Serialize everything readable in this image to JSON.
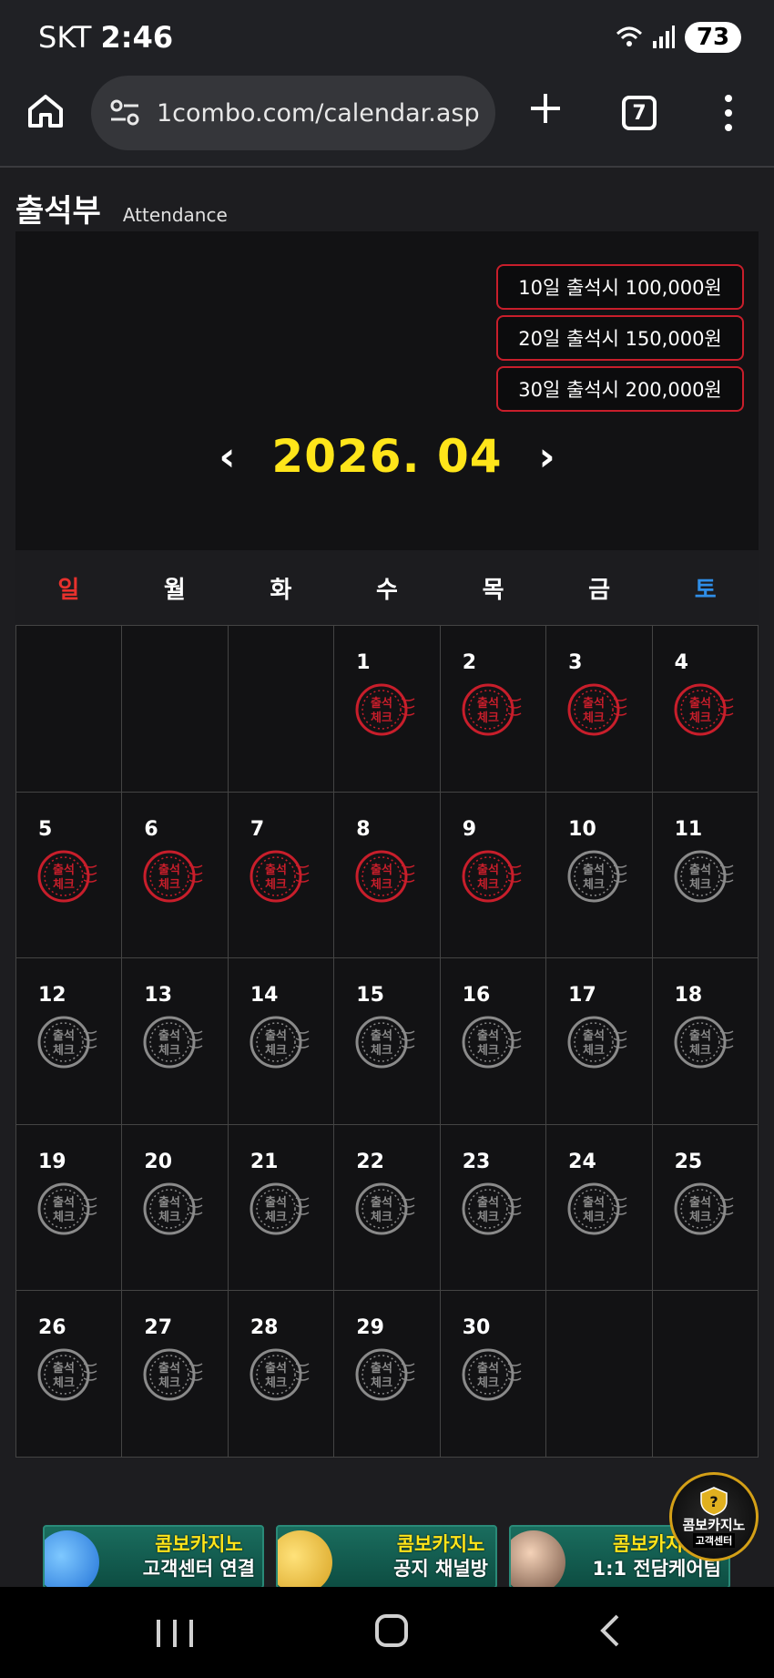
{
  "status_bar": {
    "carrier": "SKT",
    "time": "2:46",
    "battery": "73"
  },
  "browser": {
    "url": "1combo.com/calendar.asp",
    "tab_count": "7"
  },
  "page": {
    "title": "출석부",
    "subtitle": "Attendance"
  },
  "rewards": [
    "10일 출석시 100,000원",
    "20일 출석시 150,000원",
    "30일 출석시 200,000원"
  ],
  "calendar": {
    "month_label": "2026. 04",
    "prev_arrow": "‹",
    "next_arrow": "›",
    "weekdays": [
      "일",
      "월",
      "화",
      "수",
      "목",
      "금",
      "토"
    ],
    "stamp_text_top": "출석",
    "stamp_text_bottom": "체크",
    "leading_blanks": 3,
    "days_in_month": 30,
    "checked_days": [
      1,
      2,
      3,
      4,
      5,
      6,
      7,
      8,
      9
    ],
    "checked_color": "#c81e2b",
    "unchecked_color": "#8a8a8a"
  },
  "banners": [
    {
      "line1": "콤보카지노",
      "line2": "고객센터 연결"
    },
    {
      "line1": "콤보카지노",
      "line2": "공지 채널방"
    },
    {
      "line1": "콤보카지노",
      "line2": "1:1 전담케어팀"
    }
  ],
  "support_badge": {
    "line1": "콤보카지노",
    "line2": "고객센터"
  }
}
